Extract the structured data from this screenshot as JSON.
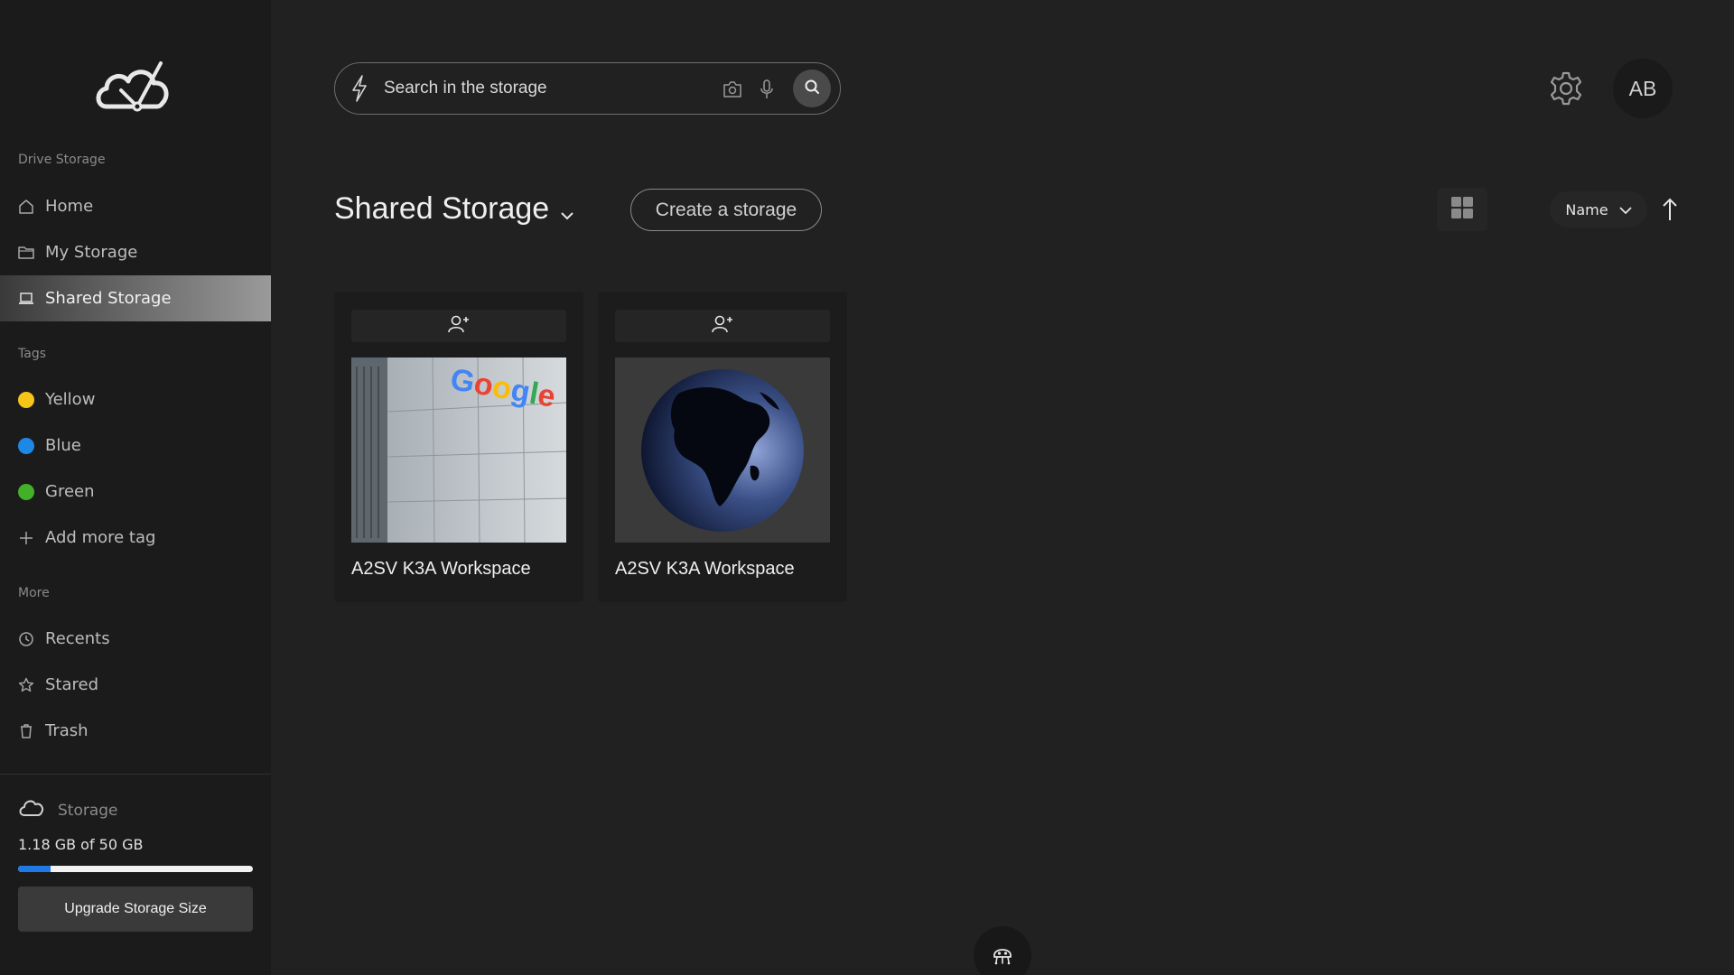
{
  "sidebar": {
    "sections": {
      "drive": "Drive Storage",
      "tags": "Tags",
      "more": "More"
    },
    "drive_items": [
      {
        "label": "Home",
        "icon": "home-icon"
      },
      {
        "label": "My Storage",
        "icon": "folder-icon"
      },
      {
        "label": "Shared Storage",
        "icon": "laptop-icon",
        "active": true
      }
    ],
    "tag_items": [
      {
        "label": "Yellow",
        "color": "#f5c518"
      },
      {
        "label": "Blue",
        "color": "#1e88e5"
      },
      {
        "label": "Green",
        "color": "#43b02a"
      }
    ],
    "add_tag_label": "Add more tag",
    "more_items": [
      {
        "label": "Recents",
        "icon": "clock-icon"
      },
      {
        "label": "Stared",
        "icon": "star-icon"
      },
      {
        "label": "Trash",
        "icon": "trash-icon"
      }
    ],
    "storage": {
      "label": "Storage",
      "usage_text": "1.18 GB of 50 GB",
      "used_fraction": 0.0236,
      "upgrade_label": "Upgrade Storage Size"
    }
  },
  "search": {
    "placeholder": "Search in the storage"
  },
  "user": {
    "initials": "AB"
  },
  "main": {
    "title": "Shared Storage",
    "create_label": "Create a storage",
    "sort_label": "Name"
  },
  "cards": [
    {
      "title": "A2SV K3A Workspace",
      "image": "google-office-building",
      "logo_text": "Google"
    },
    {
      "title": "A2SV K3A Workspace",
      "image": "globe-africa"
    }
  ],
  "colors": {
    "accent": "#1e78e6",
    "background": "#212121",
    "sidebar": "#1b1b1b"
  }
}
